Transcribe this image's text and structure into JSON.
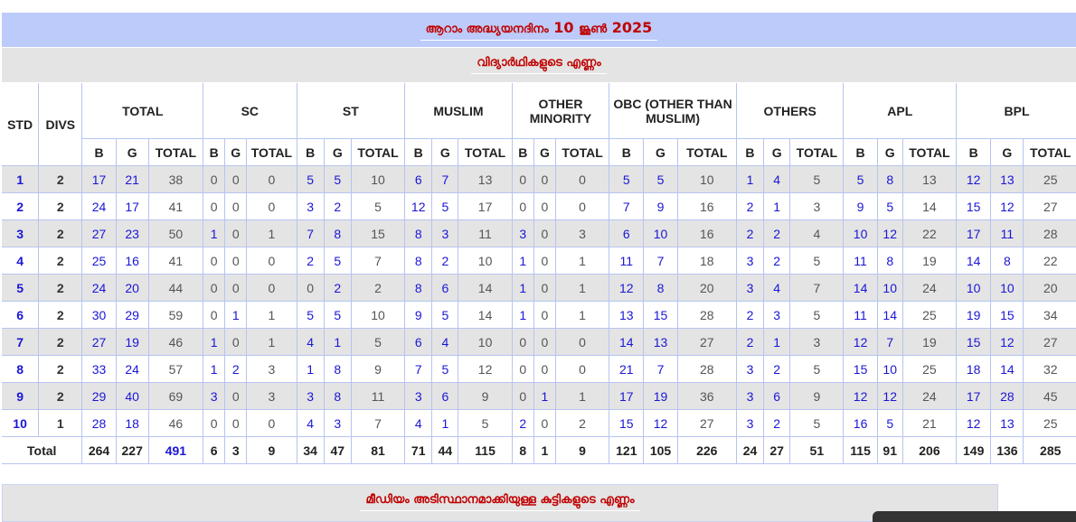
{
  "header": {
    "title_prefix": "ആറാം അദ്ധ്യയനദിനം",
    "title_num": "10",
    "title_month": "ജൂൺ",
    "title_year": "2025",
    "subtitle": "വിദ്യാർഥികളുടെ എണ്ണം"
  },
  "table": {
    "col_std": "STD",
    "col_divs": "DIVS",
    "groups": [
      {
        "label": "TOTAL"
      },
      {
        "label": "SC"
      },
      {
        "label": "ST"
      },
      {
        "label": "MUSLIM"
      },
      {
        "label": "OTHER MINORITY"
      },
      {
        "label": "OBC (OTHER THAN MUSLIM)"
      },
      {
        "label": "OTHERS"
      },
      {
        "label": "APL"
      },
      {
        "label": "BPL"
      }
    ],
    "sub": {
      "b": "B",
      "g": "G",
      "total": "TOTAL"
    },
    "rows": [
      {
        "std": "1",
        "divs": "2",
        "v": [
          "17",
          "21",
          "38",
          "0",
          "0",
          "0",
          "5",
          "5",
          "10",
          "6",
          "7",
          "13",
          "0",
          "0",
          "0",
          "5",
          "5",
          "10",
          "1",
          "4",
          "5",
          "5",
          "8",
          "13",
          "12",
          "13",
          "25"
        ]
      },
      {
        "std": "2",
        "divs": "2",
        "v": [
          "24",
          "17",
          "41",
          "0",
          "0",
          "0",
          "3",
          "2",
          "5",
          "12",
          "5",
          "17",
          "0",
          "0",
          "0",
          "7",
          "9",
          "16",
          "2",
          "1",
          "3",
          "9",
          "5",
          "14",
          "15",
          "12",
          "27"
        ]
      },
      {
        "std": "3",
        "divs": "2",
        "v": [
          "27",
          "23",
          "50",
          "1",
          "0",
          "1",
          "7",
          "8",
          "15",
          "8",
          "3",
          "11",
          "3",
          "0",
          "3",
          "6",
          "10",
          "16",
          "2",
          "2",
          "4",
          "10",
          "12",
          "22",
          "17",
          "11",
          "28"
        ]
      },
      {
        "std": "4",
        "divs": "2",
        "v": [
          "25",
          "16",
          "41",
          "0",
          "0",
          "0",
          "2",
          "5",
          "7",
          "8",
          "2",
          "10",
          "1",
          "0",
          "1",
          "11",
          "7",
          "18",
          "3",
          "2",
          "5",
          "11",
          "8",
          "19",
          "14",
          "8",
          "22"
        ]
      },
      {
        "std": "5",
        "divs": "2",
        "v": [
          "24",
          "20",
          "44",
          "0",
          "0",
          "0",
          "0",
          "2",
          "2",
          "8",
          "6",
          "14",
          "1",
          "0",
          "1",
          "12",
          "8",
          "20",
          "3",
          "4",
          "7",
          "14",
          "10",
          "24",
          "10",
          "10",
          "20"
        ]
      },
      {
        "std": "6",
        "divs": "2",
        "v": [
          "30",
          "29",
          "59",
          "0",
          "1",
          "1",
          "5",
          "5",
          "10",
          "9",
          "5",
          "14",
          "1",
          "0",
          "1",
          "13",
          "15",
          "28",
          "2",
          "3",
          "5",
          "11",
          "14",
          "25",
          "19",
          "15",
          "34"
        ]
      },
      {
        "std": "7",
        "divs": "2",
        "v": [
          "27",
          "19",
          "46",
          "1",
          "0",
          "1",
          "4",
          "1",
          "5",
          "6",
          "4",
          "10",
          "0",
          "0",
          "0",
          "14",
          "13",
          "27",
          "2",
          "1",
          "3",
          "12",
          "7",
          "19",
          "15",
          "12",
          "27"
        ]
      },
      {
        "std": "8",
        "divs": "2",
        "v": [
          "33",
          "24",
          "57",
          "1",
          "2",
          "3",
          "1",
          "8",
          "9",
          "7",
          "5",
          "12",
          "0",
          "0",
          "0",
          "21",
          "7",
          "28",
          "3",
          "2",
          "5",
          "15",
          "10",
          "25",
          "18",
          "14",
          "32"
        ]
      },
      {
        "std": "9",
        "divs": "2",
        "v": [
          "29",
          "40",
          "69",
          "3",
          "0",
          "3",
          "3",
          "8",
          "11",
          "3",
          "6",
          "9",
          "0",
          "1",
          "1",
          "17",
          "19",
          "36",
          "3",
          "6",
          "9",
          "12",
          "12",
          "24",
          "17",
          "28",
          "45"
        ]
      },
      {
        "std": "10",
        "divs": "1",
        "v": [
          "28",
          "18",
          "46",
          "0",
          "0",
          "0",
          "4",
          "3",
          "7",
          "4",
          "1",
          "5",
          "2",
          "0",
          "2",
          "15",
          "12",
          "27",
          "3",
          "2",
          "5",
          "16",
          "5",
          "21",
          "12",
          "13",
          "25"
        ]
      }
    ],
    "total_row": {
      "label": "Total",
      "divs": "264",
      "v": [
        "227",
        "491",
        "6",
        "3",
        "9",
        "34",
        "47",
        "81",
        "71",
        "44",
        "115",
        "8",
        "1",
        "9",
        "121",
        "105",
        "226",
        "24",
        "27",
        "51",
        "115",
        "91",
        "206",
        "149",
        "136",
        "285"
      ]
    }
  },
  "bottom": {
    "subtitle": "മീഡിയം അടിസ്ഥാനമാക്കിയുള്ള കുട്ടികളുടെ എണ്ണം"
  }
}
